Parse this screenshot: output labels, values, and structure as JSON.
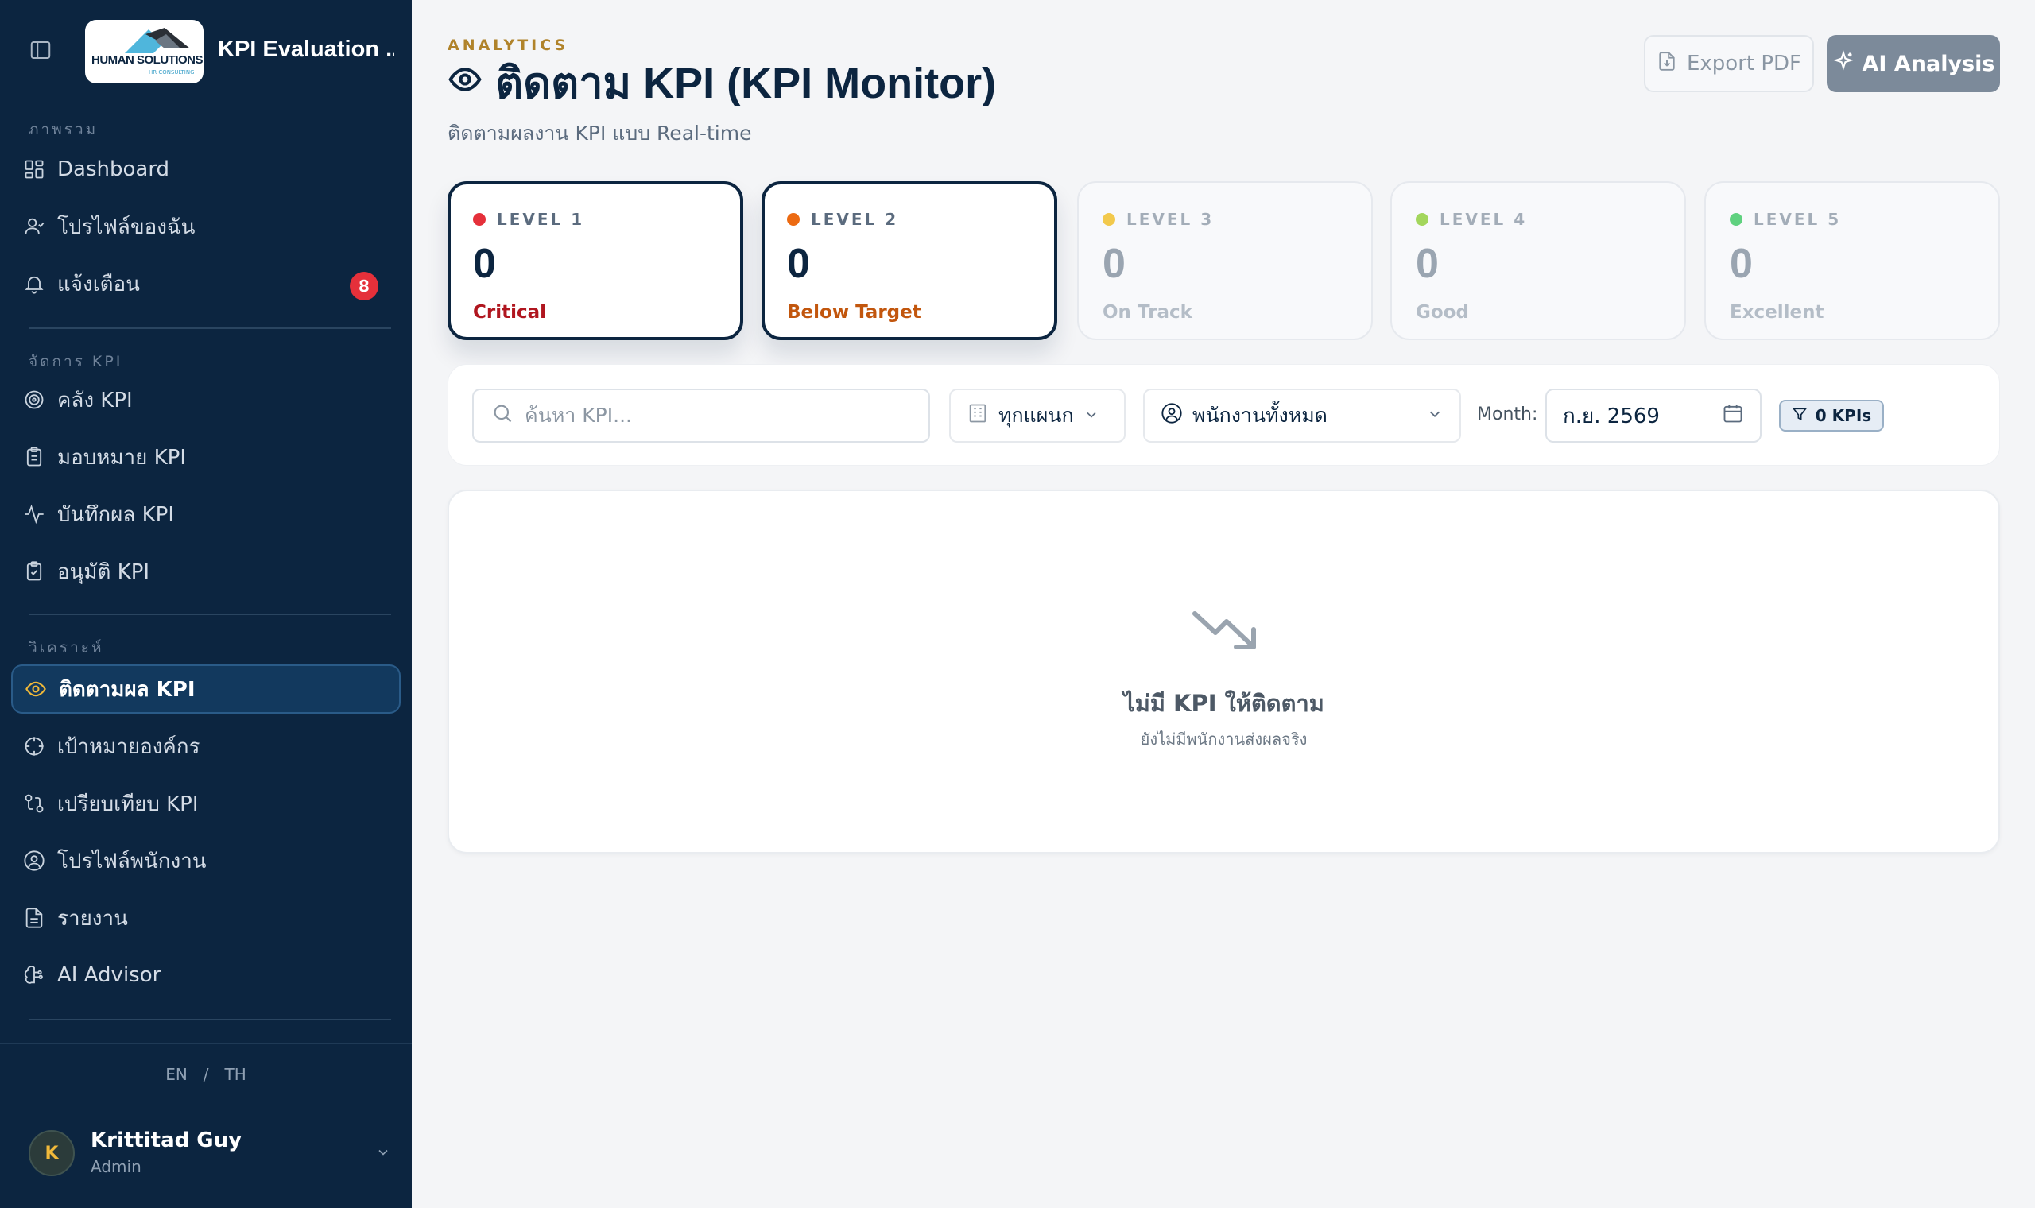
{
  "app": {
    "title": "KPI Evaluation ...",
    "logo_text": "HUMAN SOLUTIONS",
    "logo_sub": "HR CONSULTING"
  },
  "sidebar": {
    "sections": [
      {
        "label": "ภาพรวม"
      },
      {
        "label": "จัดการ KPI"
      },
      {
        "label": "วิเคราะห์"
      }
    ],
    "items": [
      {
        "label": "Dashboard",
        "icon": "grid-icon"
      },
      {
        "label": "โปรไฟล์ของฉัน",
        "icon": "user-icon"
      },
      {
        "label": "แจ้งเตือน",
        "icon": "bell-icon",
        "badge": "8"
      },
      {
        "label": "คลัง KPI",
        "icon": "target-icon"
      },
      {
        "label": "มอบหมาย KPI",
        "icon": "clipboard-icon"
      },
      {
        "label": "บันทึกผล KPI",
        "icon": "activity-icon"
      },
      {
        "label": "อนุมัติ KPI",
        "icon": "clipboard-check-icon"
      },
      {
        "label": "ติดตามผล KPI",
        "icon": "eye-icon",
        "active": true
      },
      {
        "label": "เป้าหมายองค์กร",
        "icon": "crosshair-icon"
      },
      {
        "label": "เปรียบเทียบ KPI",
        "icon": "compare-icon"
      },
      {
        "label": "โปรไฟล์พนักงาน",
        "icon": "user-circle-icon"
      },
      {
        "label": "รายงาน",
        "icon": "file-text-icon"
      },
      {
        "label": "AI Advisor",
        "icon": "brain-icon"
      }
    ],
    "lang": {
      "en": "EN",
      "sep": "/",
      "th": "TH"
    },
    "user": {
      "initial": "K",
      "name": "Krittitad Guy",
      "role": "Admin"
    }
  },
  "header": {
    "eyebrow": "ANALYTICS",
    "title": "ติดตาม KPI (KPI Monitor)",
    "subtitle": "ติดตามผลงาน KPI แบบ Real-time",
    "export_label": "Export PDF",
    "ai_label": "AI Analysis"
  },
  "levels": [
    {
      "label": "LEVEL 1",
      "count": "0",
      "desc": "Critical",
      "color": "#e5303a",
      "desc_color": "#b0161f",
      "selected": true
    },
    {
      "label": "LEVEL 2",
      "count": "0",
      "desc": "Below Target",
      "color": "#ec6a12",
      "desc_color": "#c2560d",
      "selected": true
    },
    {
      "label": "LEVEL 3",
      "count": "0",
      "desc": "On Track",
      "color": "#f2c94c",
      "selected": false
    },
    {
      "label": "LEVEL 4",
      "count": "0",
      "desc": "Good",
      "color": "#a3d65c",
      "selected": false
    },
    {
      "label": "LEVEL 5",
      "count": "0",
      "desc": "Excellent",
      "color": "#5fd17f",
      "selected": false
    }
  ],
  "filters": {
    "search_placeholder": "ค้นหา KPI...",
    "department": "ทุกแผนก",
    "employee": "พนักงานทั้งหมด",
    "month_label": "Month:",
    "month_value": "ก.ย. 2569",
    "kpi_count": "0 KPIs"
  },
  "empty": {
    "title": "ไม่มี KPI ให้ติดตาม",
    "subtitle": "ยังไม่มีพนักงานส่งผลจริง"
  }
}
